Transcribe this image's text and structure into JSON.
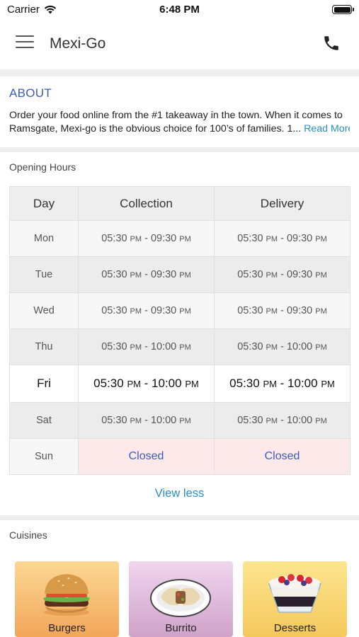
{
  "status_bar": {
    "carrier": "Carrier",
    "time": "6:48 PM"
  },
  "header": {
    "title": "Mexi-Go"
  },
  "about": {
    "title": "ABOUT",
    "line1": "Order your food online from the #1 takeaway in the town. When it comes to",
    "line2": "Ramsgate, Mexi-go is the obvious choice for 100’s of families. 1...",
    "read_more": "Read More"
  },
  "opening_hours": {
    "title": "Opening Hours",
    "columns": [
      "Day",
      "Collection",
      "Delivery"
    ],
    "rows": [
      {
        "day": "Mon",
        "collection": {
          "from": "05:30",
          "from_ampm": "PM",
          "to": "09:30",
          "to_ampm": "PM"
        },
        "delivery": {
          "from": "05:30",
          "from_ampm": "PM",
          "to": "09:30",
          "to_ampm": "PM"
        }
      },
      {
        "day": "Tue",
        "collection": {
          "from": "05:30",
          "from_ampm": "PM",
          "to": "09:30",
          "to_ampm": "PM"
        },
        "delivery": {
          "from": "05:30",
          "from_ampm": "PM",
          "to": "09:30",
          "to_ampm": "PM"
        }
      },
      {
        "day": "Wed",
        "collection": {
          "from": "05:30",
          "from_ampm": "PM",
          "to": "09:30",
          "to_ampm": "PM"
        },
        "delivery": {
          "from": "05:30",
          "from_ampm": "PM",
          "to": "09:30",
          "to_ampm": "PM"
        }
      },
      {
        "day": "Thu",
        "collection": {
          "from": "05:30",
          "from_ampm": "PM",
          "to": "10:00",
          "to_ampm": "PM"
        },
        "delivery": {
          "from": "05:30",
          "from_ampm": "PM",
          "to": "10:00",
          "to_ampm": "PM"
        }
      },
      {
        "day": "Fri",
        "collection": {
          "from": "05:30",
          "from_ampm": "PM",
          "to": "10:00",
          "to_ampm": "PM"
        },
        "delivery": {
          "from": "05:30",
          "from_ampm": "PM",
          "to": "10:00",
          "to_ampm": "PM"
        }
      },
      {
        "day": "Sat",
        "collection": {
          "from": "05:30",
          "from_ampm": "PM",
          "to": "10:00",
          "to_ampm": "PM"
        },
        "delivery": {
          "from": "05:30",
          "from_ampm": "PM",
          "to": "10:00",
          "to_ampm": "PM"
        }
      },
      {
        "day": "Sun",
        "collection_closed": "Closed",
        "delivery_closed": "Closed"
      }
    ],
    "view_less": "View less"
  },
  "cuisines": {
    "title": "Cuisines",
    "items": [
      {
        "label": "Burgers",
        "icon": "burger-icon"
      },
      {
        "label": "Burrito",
        "icon": "burrito-icon"
      },
      {
        "label": "Desserts",
        "icon": "dessert-icon"
      }
    ]
  },
  "colors": {
    "accent_blue": "#3c5cb8",
    "link_blue": "#2b8fc2",
    "closed_bg": "#fde8ea"
  }
}
